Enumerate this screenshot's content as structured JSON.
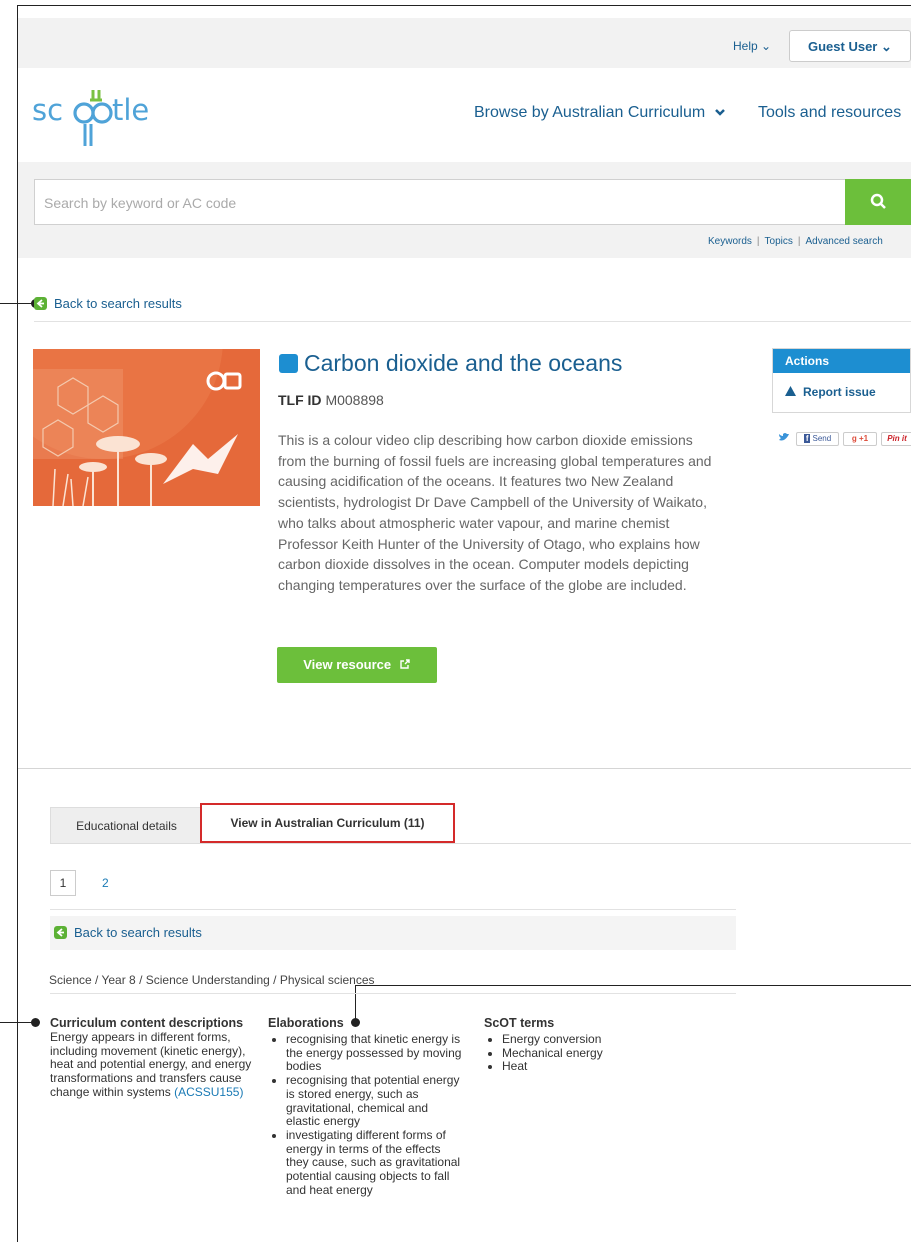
{
  "header": {
    "help_label": "Help ⌄",
    "user_label": "Guest User ⌄"
  },
  "logo": {
    "text": "scootle",
    "brand_color": "#4fa3d8",
    "accent_color": "#7ac142"
  },
  "nav": {
    "browse_label": "Browse by Australian Curriculum",
    "tools_label": "Tools and resources"
  },
  "search": {
    "placeholder": "Search by keyword or AC code",
    "links": [
      "Keywords",
      "Topics",
      "Advanced search"
    ]
  },
  "back_label": "Back to search results",
  "resource": {
    "title": "Carbon dioxide and the oceans",
    "id_label": "TLF ID",
    "id_value": "M008898",
    "description": "This is a colour video clip describing how carbon dioxide emissions from the burning of fossil fuels are increasing global temperatures and causing acidification of the oceans. It features two New Zealand scientists, hydrologist Dr Dave Campbell of the University of Waikato, who talks about atmospheric water vapour, and marine chemist Professor Keith Hunter of the University of Otago, who explains how carbon dioxide dissolves in the ocean. Computer models depicting changing temperatures over the surface of the globe are included.",
    "view_button": "View resource"
  },
  "actions": {
    "heading": "Actions",
    "report_label": "Report issue",
    "social": [
      "Send",
      "+1",
      "Pin it"
    ]
  },
  "tabs": [
    {
      "label": "Educational details"
    },
    {
      "label": "View in Australian Curriculum (11)"
    }
  ],
  "pagination": [
    "1",
    "2"
  ],
  "breadcrumb": "Science / Year 8 / Science Understanding / Physical sciences",
  "curriculum": {
    "content_heading": "Curriculum content descriptions",
    "content_text": "Energy appears in different forms, including movement (kinetic energy), heat and potential energy, and energy transformations and transfers cause change within systems",
    "content_code": "(ACSSU155)",
    "elaborations_heading": "Elaborations",
    "elaborations": [
      "recognising that kinetic energy is the energy possessed by moving bodies",
      "recognising that potential energy is stored energy, such as gravitational, chemical and elastic energy",
      "investigating different forms of energy in terms of the effects they cause, such as gravitational potential causing objects to fall and heat energy"
    ],
    "scot_heading": "ScOT terms",
    "scot_terms": [
      "Energy conversion",
      "Mechanical energy",
      "Heat"
    ]
  }
}
